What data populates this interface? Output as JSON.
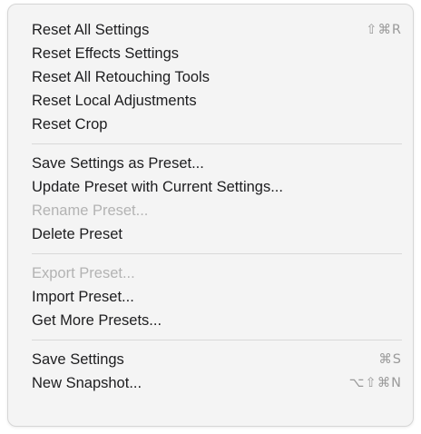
{
  "menu": {
    "groups": [
      [
        {
          "label": "Reset All Settings",
          "shortcut": "⇧⌘R",
          "enabled": true
        },
        {
          "label": "Reset Effects Settings",
          "shortcut": "",
          "enabled": true
        },
        {
          "label": "Reset All Retouching Tools",
          "shortcut": "",
          "enabled": true
        },
        {
          "label": "Reset Local Adjustments",
          "shortcut": "",
          "enabled": true
        },
        {
          "label": "Reset Crop",
          "shortcut": "",
          "enabled": true
        }
      ],
      [
        {
          "label": "Save Settings as Preset...",
          "shortcut": "",
          "enabled": true
        },
        {
          "label": "Update Preset with Current Settings...",
          "shortcut": "",
          "enabled": true
        },
        {
          "label": "Rename Preset...",
          "shortcut": "",
          "enabled": false
        },
        {
          "label": "Delete Preset",
          "shortcut": "",
          "enabled": true
        }
      ],
      [
        {
          "label": "Export Preset...",
          "shortcut": "",
          "enabled": false
        },
        {
          "label": "Import Preset...",
          "shortcut": "",
          "enabled": true
        },
        {
          "label": "Get More Presets...",
          "shortcut": "",
          "enabled": true
        }
      ],
      [
        {
          "label": "Save Settings",
          "shortcut": "⌘S",
          "enabled": true
        },
        {
          "label": "New Snapshot...",
          "shortcut": "⌥⇧⌘N",
          "enabled": true
        }
      ]
    ]
  },
  "colors": {
    "menu_background": "#f4f4f4",
    "text": "#1d1d1f",
    "disabled_text": "#b3b3b3",
    "shortcut_text": "#9a9a9a",
    "separator": "#d8d8d8"
  }
}
